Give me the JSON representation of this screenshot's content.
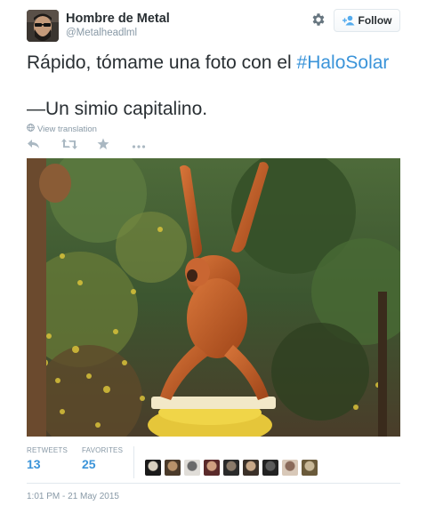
{
  "user": {
    "full_name": "Hombre de Metal",
    "username": "@Metalheadlml",
    "avatar_icon": "bearded-man-sunglasses-avatar"
  },
  "follow_button": {
    "label": "Follow",
    "icon": "add-user-icon"
  },
  "settings_icon": "gear-icon",
  "tweet": {
    "text_before_hashtag": "Rápido, tómame una foto con el ",
    "hashtag": "#HaloSolar",
    "text_line2": "—Un simio capitalino."
  },
  "view_translation": {
    "label": "View translation",
    "icon": "globe-icon"
  },
  "actions": [
    "reply-icon",
    "retweet-icon",
    "favorite-star-icon",
    "more-icon"
  ],
  "photo": {
    "subject": "orangutan hanging from branches over a banana platform"
  },
  "stats": {
    "retweets": {
      "label": "RETWEETS",
      "value": "13"
    },
    "favorites": {
      "label": "FAVORITES",
      "value": "25"
    },
    "favoriter_avatar_count": 9
  },
  "timestamp": "1:01 PM - 21 May 2015",
  "colors": {
    "link": "#3b94d9",
    "text": "#292f33",
    "muted": "#8899a6",
    "border": "#e1e8ed"
  }
}
